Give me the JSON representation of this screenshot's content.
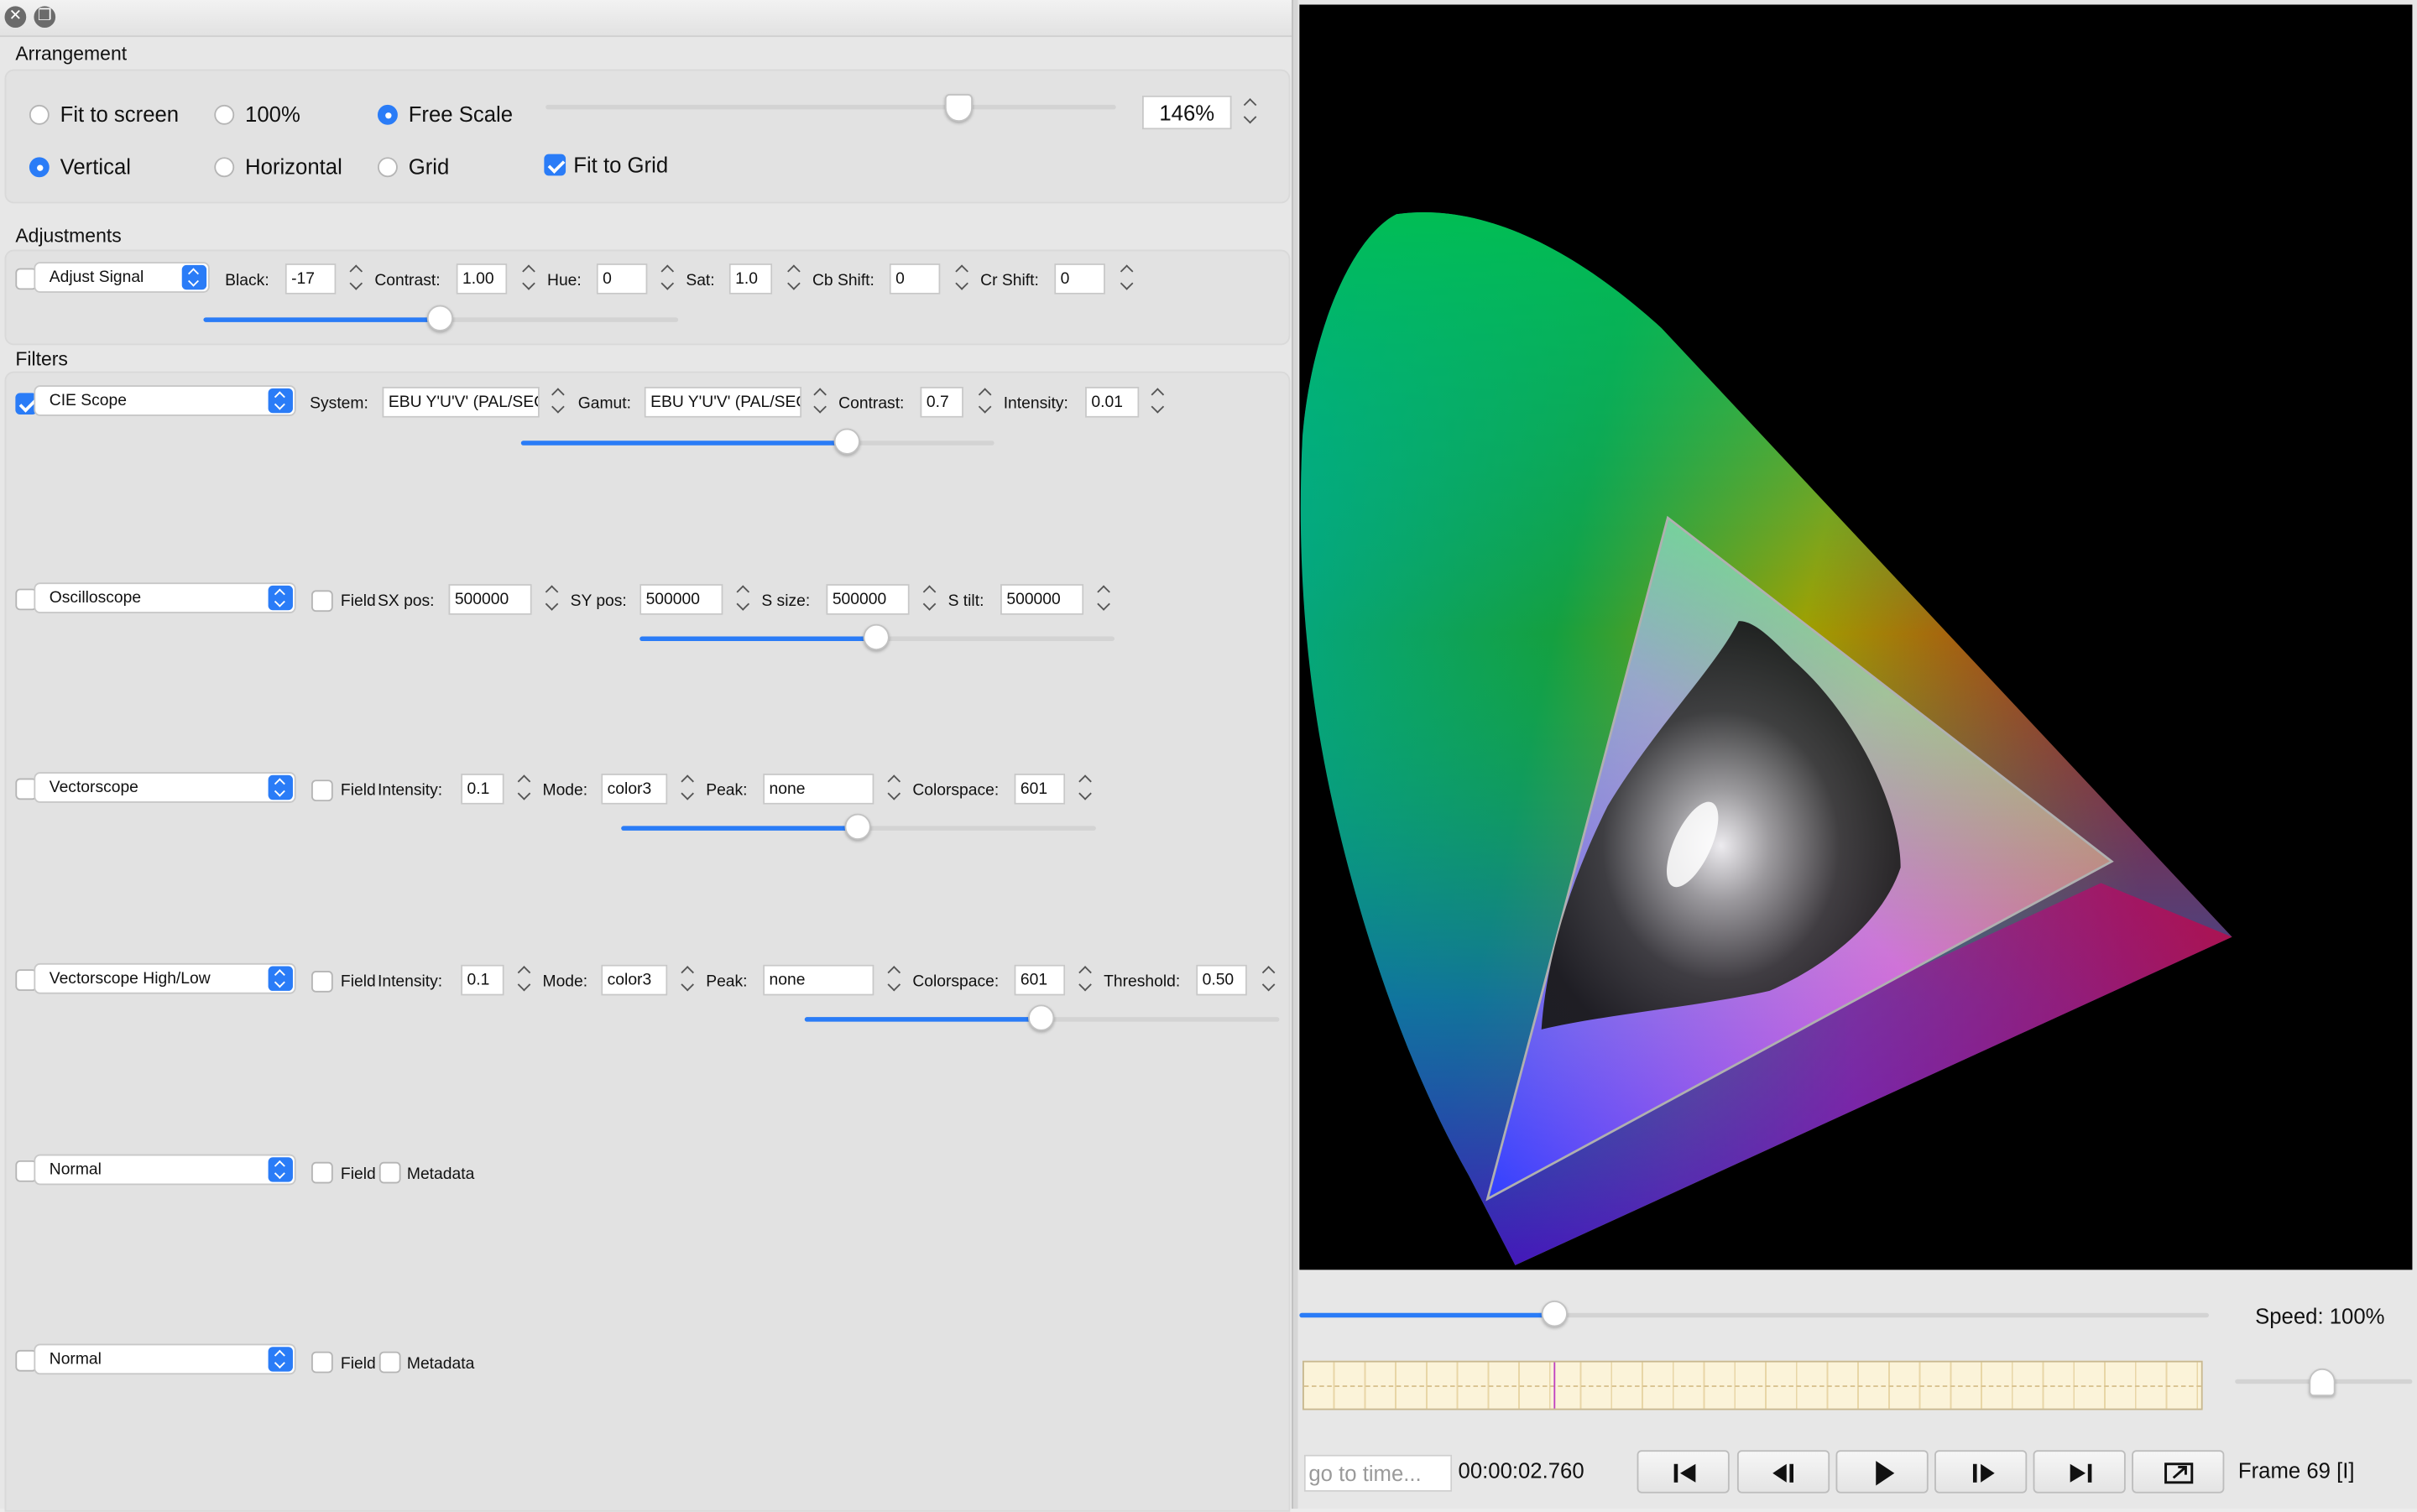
{
  "window": {
    "close_icon": "close-icon",
    "restore_icon": "restore-icon"
  },
  "arrangement": {
    "title": "Arrangement",
    "scale_options": [
      {
        "label": "Fit to screen",
        "selected": false
      },
      {
        "label": "100%",
        "selected": false
      },
      {
        "label": "Free Scale",
        "selected": true
      }
    ],
    "layout_options": [
      {
        "label": "Vertical",
        "selected": true
      },
      {
        "label": "Horizontal",
        "selected": false
      },
      {
        "label": "Grid",
        "selected": false
      }
    ],
    "fit_to_grid": {
      "label": "Fit to Grid",
      "checked": true
    },
    "scale_value": "146%",
    "scale_slider_level": 0.72
  },
  "adjustments": {
    "title": "Adjustments",
    "enabled": false,
    "mode": "Adjust Signal",
    "black_label": "Black:",
    "black_value": "-17",
    "contrast_label": "Contrast:",
    "contrast_value": "1.00",
    "hue_label": "Hue:",
    "hue_value": "0",
    "sat_label": "Sat:",
    "sat_value": "1.0",
    "cb_label": "Cb Shift:",
    "cb_value": "0",
    "cr_label": "Cr Shift:",
    "cr_value": "0",
    "slider_level": 0.5
  },
  "filters": {
    "title": "Filters",
    "cie": {
      "enabled": true,
      "name": "CIE Scope",
      "system_label": "System:",
      "system_value": "EBU Y'U'V' (PAL/SECAM)",
      "gamut_label": "Gamut:",
      "gamut_value": "EBU Y'U'V' (PAL/SECAM)",
      "contrast_label": "Contrast:",
      "contrast_value": "0.7",
      "intensity_label": "Intensity:",
      "intensity_value": "0.01",
      "slider_level": 0.69
    },
    "osc": {
      "enabled": false,
      "name": "Oscilloscope",
      "field_label": "Field",
      "sx_label": "SX pos:",
      "sx_value": "500000",
      "sy_label": "SY pos:",
      "sy_value": "500000",
      "ssize_label": "S size:",
      "ssize_value": "500000",
      "stilt_label": "S tilt:",
      "stilt_value": "500000",
      "slider_level": 0.5
    },
    "vec": {
      "enabled": false,
      "name": "Vectorscope",
      "field_label": "Field",
      "intensity_label": "Intensity:",
      "intensity_value": "0.1",
      "mode_label": "Mode:",
      "mode_value": "color3",
      "peak_label": "Peak:",
      "peak_value": "none",
      "colorspace_label": "Colorspace:",
      "colorspace_value": "601",
      "slider_level": 0.5
    },
    "vechl": {
      "enabled": false,
      "name": "Vectorscope High/Low",
      "field_label": "Field",
      "intensity_label": "Intensity:",
      "intensity_value": "0.1",
      "mode_label": "Mode:",
      "mode_value": "color3",
      "peak_label": "Peak:",
      "peak_value": "none",
      "colorspace_label": "Colorspace:",
      "colorspace_value": "601",
      "threshold_label": "Threshold:",
      "threshold_value": "0.50",
      "slider_level": 0.5
    },
    "normal1": {
      "enabled": false,
      "name": "Normal",
      "field_label": "Field",
      "metadata_label": "Metadata"
    },
    "normal2": {
      "enabled": false,
      "name": "Normal",
      "field_label": "Field",
      "metadata_label": "Metadata"
    }
  },
  "player": {
    "position_level": 0.28,
    "speed_label": "Speed: 100%",
    "speed_level": 0.5,
    "goto_placeholder": "go to time...",
    "timecode": "00:00:02.760",
    "frame_label": "Frame 69 [I]",
    "buttons": [
      "go-to-start",
      "step-back",
      "play",
      "step-forward",
      "go-to-end",
      "export"
    ]
  },
  "colors": {
    "accent": "#2a7cf7",
    "timeline_bg": "#fbf3d9",
    "timeline_marker": "#c040c0"
  }
}
